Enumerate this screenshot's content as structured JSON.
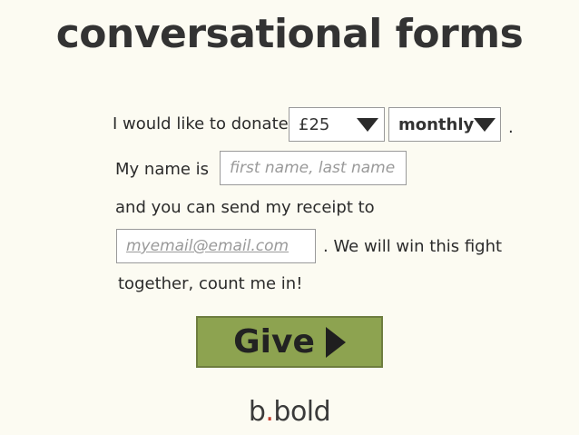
{
  "page": {
    "title": "conversational forms"
  },
  "form": {
    "donate_prefix": "I would like to donate",
    "amount_select": {
      "value": "£25",
      "icon": "triangle-down-icon"
    },
    "frequency_select": {
      "value": "monthly",
      "icon": "triangle-down-icon"
    },
    "sentence_end": ".",
    "name_prefix": "My name is",
    "name_input": {
      "placeholder": "first name, last name"
    },
    "receipt_text": "and you can send my receipt to",
    "email_input": {
      "placeholder": "myemail@email.com"
    },
    "email_suffix": ".  We will win this fight",
    "closing_text": "together, count me in!",
    "submit": {
      "label": "Give",
      "icon": "play-icon",
      "color": "#8da350"
    }
  },
  "brand": {
    "logo_pre": "b",
    "logo_dot": ".",
    "logo_post": "bold",
    "dot_color": "#c0392b"
  }
}
